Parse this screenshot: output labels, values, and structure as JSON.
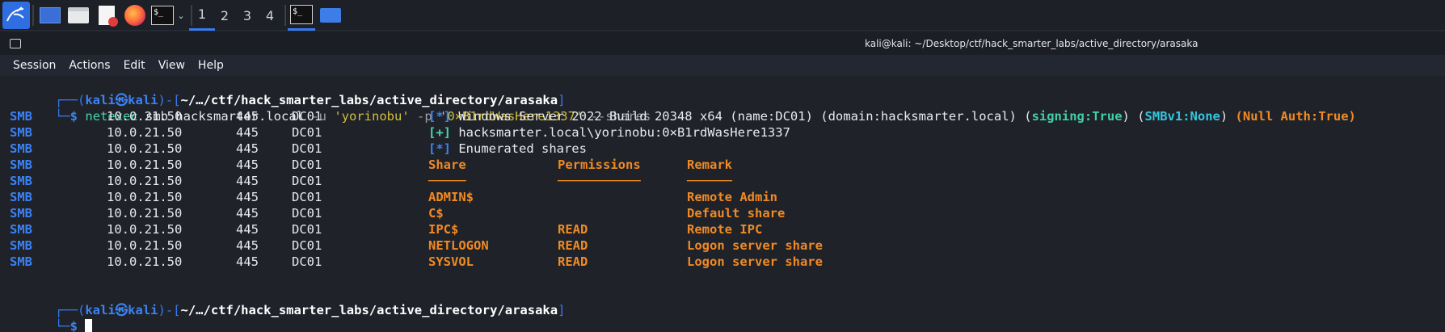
{
  "taskbar": {
    "workspaces": [
      "1",
      "2",
      "3",
      "4"
    ],
    "active_workspace": "1"
  },
  "window": {
    "title": "kali@kali: ~/Desktop/ctf/hack_smarter_labs/active_directory/arasaka",
    "menu": [
      "Session",
      "Actions",
      "Edit",
      "View",
      "Help"
    ]
  },
  "terminal": {
    "prompt": {
      "corner_top": "┌──(",
      "user": "kali",
      "at": "㉿",
      "host": "kali",
      "mid": ")-[",
      "path": "~/…/ctf/hack_smarter_labs/active_directory/arasaka",
      "end": "]",
      "corner_bottom": "└─",
      "dollar": "$"
    },
    "command": {
      "tool": "netexec",
      "args_plain": " smb hacksmarter.local ",
      "flag_u": "-u",
      "user": " 'yorinobu' ",
      "flag_p": "-p",
      "password": " '0×B1rdWasHere1337' ",
      "opt": "--shares"
    },
    "rows": [
      {
        "proto": "SMB",
        "ip": "10.0.21.50",
        "port": "445",
        "host": "DC01"
      },
      {
        "proto": "SMB",
        "ip": "10.0.21.50",
        "port": "445",
        "host": "DC01"
      },
      {
        "proto": "SMB",
        "ip": "10.0.21.50",
        "port": "445",
        "host": "DC01"
      },
      {
        "proto": "SMB",
        "ip": "10.0.21.50",
        "port": "445",
        "host": "DC01"
      },
      {
        "proto": "SMB",
        "ip": "10.0.21.50",
        "port": "445",
        "host": "DC01"
      },
      {
        "proto": "SMB",
        "ip": "10.0.21.50",
        "port": "445",
        "host": "DC01"
      },
      {
        "proto": "SMB",
        "ip": "10.0.21.50",
        "port": "445",
        "host": "DC01"
      },
      {
        "proto": "SMB",
        "ip": "10.0.21.50",
        "port": "445",
        "host": "DC01"
      },
      {
        "proto": "SMB",
        "ip": "10.0.21.50",
        "port": "445",
        "host": "DC01"
      },
      {
        "proto": "SMB",
        "ip": "10.0.21.50",
        "port": "445",
        "host": "DC01"
      }
    ],
    "info": {
      "tag_star": "[*]",
      "tag_plus": "[+]",
      "line1_text": " Windows Server 2022 Build 20348 x64 (name:DC01) (domain:hacksmarter.local) (",
      "signing": "signing:True",
      "close_open": ") (",
      "smbv1": "SMBv1:None",
      "close_space": ") ",
      "null_auth": "(Null Auth:True)",
      "line2_text": " hacksmarter.local\\yorinobu:0×B1rdWasHere1337",
      "line3_text": " Enumerated shares"
    },
    "shares_table": {
      "headers": [
        "Share",
        "Permissions",
        "Remark"
      ],
      "underline_share": "─────",
      "underline_perms": "───────────",
      "underline_remark": "──────",
      "rows": [
        {
          "share": "ADMIN$",
          "perms": "",
          "remark": "Remote Admin"
        },
        {
          "share": "C$",
          "perms": "",
          "remark": "Default share"
        },
        {
          "share": "IPC$",
          "perms": "READ",
          "remark": "Remote IPC"
        },
        {
          "share": "NETLOGON",
          "perms": "READ",
          "remark": "Logon server share"
        },
        {
          "share": "SYSVOL",
          "perms": "READ",
          "remark": "Logon server share"
        }
      ]
    }
  },
  "colors": {
    "accent": "#367bf0",
    "share_orange": "#f08a24",
    "signing_green": "#3fd1a3",
    "smbv1_cyan": "#33c7de"
  }
}
